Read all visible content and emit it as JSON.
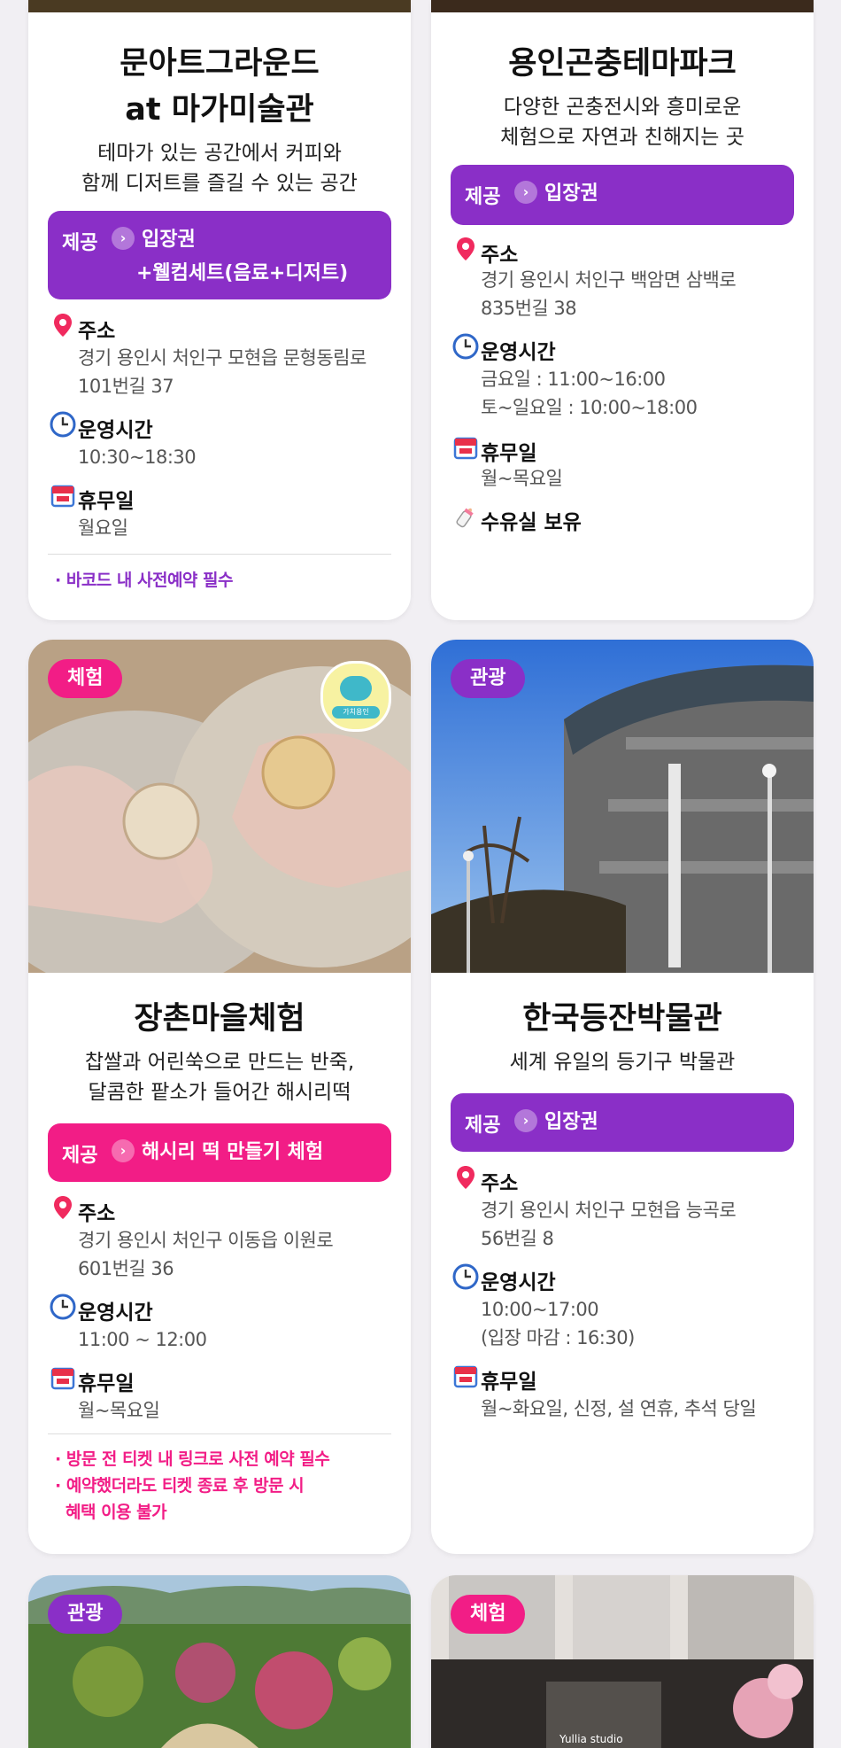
{
  "cards": {
    "moonart": {
      "title_line1": "문아트그라운드",
      "title_line2": "at 마가미술관",
      "desc_line1": "테마가 있는 공간에서 커피와",
      "desc_line2": "함께 디저트를 즐길 수 있는 공간",
      "offer_label": "제공",
      "offer_value_line1": "입장권",
      "offer_value_line2": "+웰컴세트(음료+디저트)",
      "address_title": "주소",
      "address_line1": "경기 용인시 처인구 모현읍 문형동림로",
      "address_line2": "101번길 37",
      "hours_title": "운영시간",
      "hours_line1": "10:30~18:30",
      "closed_title": "휴무일",
      "closed_line1": "월요일",
      "note_line1": "· 바코드 내 사전예약 필수"
    },
    "insect": {
      "title_line1": "용인곤충테마파크",
      "desc_line1": "다양한 곤충전시와 흥미로운",
      "desc_line2": "체험으로 자연과 친해지는 곳",
      "offer_label": "제공",
      "offer_value_line1": "입장권",
      "address_title": "주소",
      "address_line1": "경기 용인시 처인구 백암면 삼백로",
      "address_line2": "835번길 38",
      "hours_title": "운영시간",
      "hours_line1": "금요일 : 11:00~16:00",
      "hours_line2": "토~일요일 : 10:00~18:00",
      "closed_title": "휴무일",
      "closed_line1": "월~목요일",
      "nursing_title": "수유실 보유"
    },
    "jangchon": {
      "badge": "체험",
      "title_line1": "장촌마을체험",
      "desc_line1": "찹쌀과 어린쑥으로 만드는 반죽,",
      "desc_line2": "달콤한 팥소가 들어간 해시리떡",
      "offer_label": "제공",
      "offer_value_line1": "해시리 떡 만들기 체험",
      "address_title": "주소",
      "address_line1": "경기 용인시 처인구 이동읍 이원로",
      "address_line2": "601번길 36",
      "hours_title": "운영시간",
      "hours_line1": "11:00 ~ 12:00",
      "closed_title": "휴무일",
      "closed_line1": "월~목요일",
      "note_line1": "· 방문 전 티켓 내 링크로 사전 예약 필수",
      "note_line2": "· 예약했더라도 티켓 종료 후 방문 시",
      "note_line3": "혜택 이용 불가",
      "sticker_text": "가치용인"
    },
    "lamp": {
      "badge": "관광",
      "title_line1": "한국등잔박물관",
      "desc_line1": "세계 유일의 등기구 박물관",
      "offer_label": "제공",
      "offer_value_line1": "입장권",
      "address_title": "주소",
      "address_line1": "경기 용인시 처인구 모현읍 능곡로",
      "address_line2": "56번길 8",
      "hours_title": "운영시간",
      "hours_line1": "10:00~17:00",
      "hours_line2": "(입장 마감 : 16:30)",
      "closed_title": "휴무일",
      "closed_line1": "월~화요일, 신정, 설 연휴, 추석 당일"
    },
    "garden": {
      "badge": "관광"
    },
    "studio": {
      "badge": "체험",
      "sign_text": "Yullia studio"
    }
  },
  "colors": {
    "purple": "#8a2fc7",
    "pink": "#f21d86",
    "background": "#f1eff3"
  },
  "icons": [
    "location-pin-icon",
    "clock-icon",
    "calendar-icon",
    "baby-bottle-icon",
    "arrow-right-icon"
  ]
}
